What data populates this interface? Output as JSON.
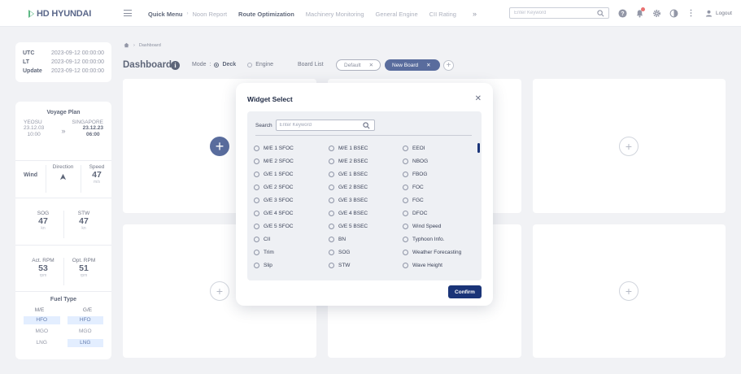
{
  "brand": {
    "name": "HD HYUNDAI",
    "color": "#1f9d55"
  },
  "nav": {
    "items": [
      {
        "label": "Quick Menu",
        "bold": true
      },
      {
        "label": "Noon Report",
        "bold": false
      },
      {
        "label": "Route Optimization",
        "bold": true
      },
      {
        "label": "Machinery Monitoring",
        "bold": false
      },
      {
        "label": "General Engine",
        "bold": false
      },
      {
        "label": "CII Rating",
        "bold": false
      }
    ],
    "more_icon": "double-chevron-right-icon"
  },
  "header": {
    "search_placeholder": "Enter Keyword",
    "icons": [
      "help-icon",
      "notification-bell-icon",
      "settings-gear-icon",
      "theme-contrast-icon",
      "more-vertical-icon"
    ],
    "logout_label": "Logout"
  },
  "time": {
    "rows": [
      {
        "label": "UTC",
        "value": "2023-09-12 00:00:00"
      },
      {
        "label": "LT",
        "value": "2023-09-12 00:00:00"
      },
      {
        "label": "Update",
        "value": "2023-09-12 00:00:00"
      }
    ]
  },
  "voyage": {
    "title": "Voyage Plan",
    "from": "YEOSU",
    "to": "SINGAPORE",
    "from_date": "23.12.03",
    "from_time": "10:00",
    "to_date": "23.12.23",
    "to_time": "06:00"
  },
  "wind": {
    "label": "Wind",
    "direction_label": "Direction",
    "speed_label": "Speed",
    "speed_value": "47",
    "speed_unit": "m/s"
  },
  "sog": {
    "label": "SOG",
    "value": "47",
    "unit": "kn"
  },
  "stw": {
    "label": "STW",
    "value": "47",
    "unit": "kn"
  },
  "act_rpm": {
    "label": "Act. RPM",
    "value": "53",
    "unit": "rpm"
  },
  "opt_rpm": {
    "label": "Opt. RPM",
    "value": "51",
    "unit": "rpm"
  },
  "fuel": {
    "title": "Fuel Type",
    "col_me": "M/E",
    "col_ge": "G/E",
    "rows": [
      {
        "me": "HFO",
        "ge": "HFO",
        "me_on": true,
        "ge_on": true
      },
      {
        "me": "MGO",
        "ge": "MGO",
        "me_on": false,
        "ge_on": false
      },
      {
        "me": "LNG",
        "ge": "LNG",
        "me_on": false,
        "ge_on": true
      }
    ]
  },
  "dashboard": {
    "breadcrumb": "Dashboard",
    "title": "Dashboard",
    "mode_label": "Mode",
    "mode_deck": "Deck",
    "mode_engine": "Engine",
    "mode_selected": "Deck",
    "board_list_label": "Board List",
    "boards": [
      "Default",
      "New Board"
    ],
    "active_board": "New Board"
  },
  "modal": {
    "title": "Widget Select",
    "search_label": "Search",
    "search_placeholder": "Enter Keyword",
    "options": [
      "M/E 1 SFOC",
      "M/E 1 BSEC",
      "EEOI",
      "M/E 2 SFOC",
      "M/E 2 BSEC",
      "NBOG",
      "G/E 1 SFOC",
      "G/E 1 BSEC",
      "FBOG",
      "G/E 2 SFOC",
      "G/E 2 BSEC",
      "FOC",
      "G/E 3 SFOC",
      "G/E 3 BSEC",
      "FGC",
      "G/E 4 SFOC",
      "G/E 4 BSEC",
      "DFOC",
      "G/E 5 SFOC",
      "G/E 5 BSEC",
      "Wind Speed",
      "CII",
      "BN",
      "Typhoon Info.",
      "Trim",
      "SOG",
      "Weather Forecasting",
      "Slip",
      "STW",
      "Wave Height"
    ],
    "confirm_label": "Confirm"
  },
  "colors": {
    "primary": "#1a3478",
    "alert": "#e23b3b",
    "highlight": "#d8e8ff"
  }
}
